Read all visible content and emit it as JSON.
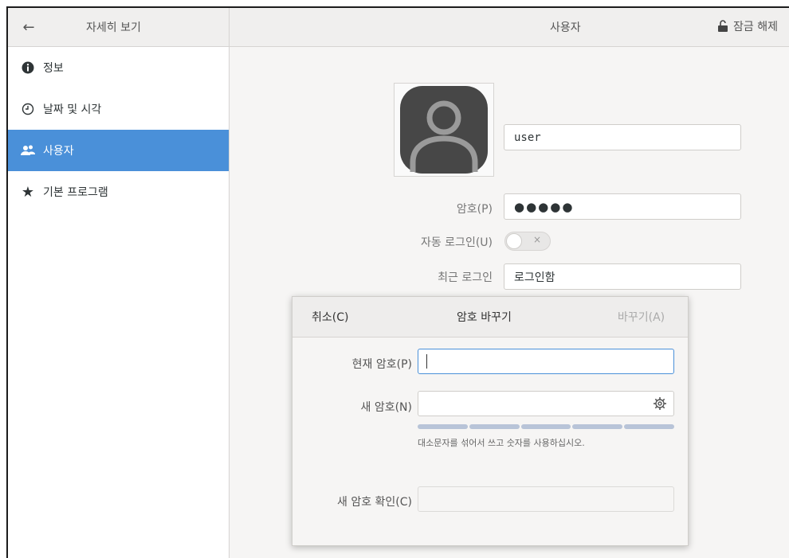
{
  "header": {
    "left_title": "자세히 보기",
    "center_title": "사용자",
    "unlock_label": "잠금 해제"
  },
  "sidebar": {
    "items": [
      {
        "label": "정보",
        "icon": "info-icon"
      },
      {
        "label": "날짜 및 시각",
        "icon": "clock-icon"
      },
      {
        "label": "사용자",
        "icon": "users-icon",
        "active": true
      },
      {
        "label": "기본 프로그램",
        "icon": "star-icon"
      }
    ]
  },
  "user": {
    "username": "user",
    "password_label": "암호(P)",
    "password_value": "●●●●●",
    "autologin_label": "자동 로그인(U)",
    "autologin_state": "×",
    "last_login_label": "최근 로그인",
    "last_login_value": "로그인함"
  },
  "dialog": {
    "cancel": "취소(C)",
    "title": "암호 바꾸기",
    "change": "바꾸기(A)",
    "current_label": "현재 암호(P)",
    "new_label": "새 암호(N)",
    "hint": "대소문자를 섞어서 쓰고 숫자를 사용하십시오.",
    "confirm_label": "새 암호 확인(C)"
  },
  "colors": {
    "accent": "#4a90d9"
  }
}
